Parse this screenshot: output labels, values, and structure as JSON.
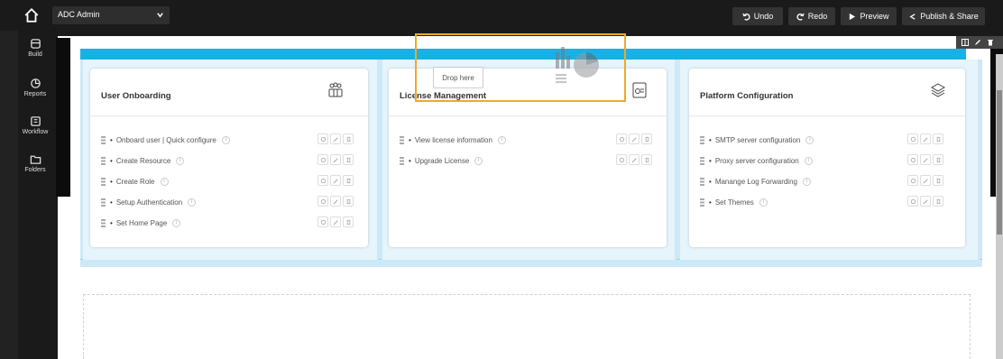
{
  "app": {
    "selected_app": "ADC Admin"
  },
  "toolbar": {
    "undo_label": "Undo",
    "redo_label": "Redo",
    "preview_label": "Preview",
    "publish_label": "Publish & Share"
  },
  "sidebar": {
    "items": [
      {
        "label": "Build",
        "icon": "build-icon"
      },
      {
        "label": "Reports",
        "icon": "reports-icon"
      },
      {
        "label": "Workflow",
        "icon": "workflow-icon"
      },
      {
        "label": "Folders",
        "icon": "folder-icon"
      }
    ]
  },
  "drop_zone": {
    "label": "Drop here"
  },
  "cards": [
    {
      "title": "User Onboarding",
      "icon": "users-group-icon",
      "items": [
        "Onboard user | Quick configure",
        "Create Resource",
        "Create Role",
        "Setup Authentication",
        "Set Home Page"
      ]
    },
    {
      "title": "License Management",
      "icon": "license-icon",
      "items": [
        "View license information",
        "Upgrade License"
      ]
    },
    {
      "title": "Platform Configuration",
      "icon": "layers-icon",
      "items": [
        "SMTP server configuration",
        "Proxy server configuration",
        "Manange Log Forwarding",
        "Set Themes"
      ]
    }
  ],
  "colors": {
    "accent_blue": "#1ab0e6",
    "drop_highlight": "#f2a828",
    "topbar": "#1a1a1a"
  }
}
